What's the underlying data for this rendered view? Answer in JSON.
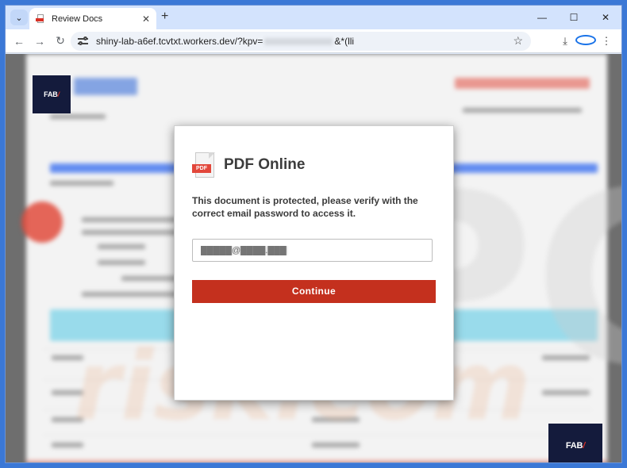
{
  "browser": {
    "tab_title": "Review Docs",
    "tab_close_glyph": "✕",
    "new_tab_glyph": "+",
    "minimize_glyph": "—",
    "maximize_glyph": "☐",
    "close_glyph": "✕",
    "url_prefix": "shiny-lab-a6ef.tcvtxt.workers.dev/?kpv=",
    "url_suffix": "&*(lli",
    "back_glyph": "←",
    "forward_glyph": "→",
    "reload_glyph": "↻",
    "star_glyph": "☆",
    "download_glyph": "⤓",
    "menu_glyph": "⋮",
    "tab_search_glyph": "⌄"
  },
  "modal": {
    "title": "PDF Online",
    "pdf_label": "PDF",
    "message": "This document is protected, please verify with the correct email password to access it.",
    "email_placeholder": "█████@████.███",
    "continue_label": "Continue"
  },
  "background_doc": {
    "logo_text": "FAB",
    "logo_mark": "/"
  },
  "colors": {
    "accent_red": "#c4301e",
    "logo_navy": "#141b3c",
    "browser_blue": "#d3e3fd"
  },
  "icons": [
    "search-tabs-icon",
    "close-icon",
    "new-tab-icon",
    "back-icon",
    "forward-icon",
    "reload-icon",
    "site-settings-icon",
    "star-icon",
    "download-icon",
    "profile-icon",
    "menu-icon",
    "pdf-icon"
  ]
}
